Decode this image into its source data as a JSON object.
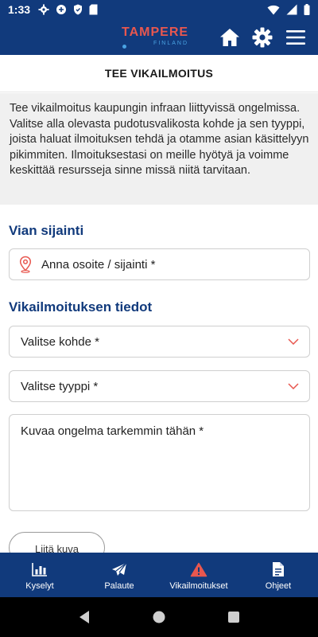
{
  "status": {
    "time": "1:33"
  },
  "header": {
    "logo_text": "TAMPERE",
    "logo_sub": "FINLAND",
    "home_icon": "home-icon",
    "settings_icon": "gear-icon",
    "menu_icon": "hamburger-menu-icon"
  },
  "page": {
    "title": "TEE VIKAILMOITUS",
    "intro": "Tee vikailmoitus kaupungin infraan liittyvissä ongelmissa. Valitse alla olevasta pudotusvalikosta kohde ja sen tyyppi, joista haluat ilmoituksen tehdä ja otamme asian käsittelyyn pikimmiten. Ilmoituksestasi on meille hyötyä ja voimme keskittää resursseja sinne missä niitä tarvitaan."
  },
  "location": {
    "heading": "Vian sijainti",
    "placeholder": "Anna osoite / sijainti *"
  },
  "details": {
    "heading": "Vikailmoituksen tiedot",
    "target_select": "Valitse kohde *",
    "type_select": "Valitse tyyppi *",
    "description_placeholder": "Kuvaa ongelma tarkemmin tähän *",
    "attach_button": "Liitä kuva"
  },
  "tabs": [
    {
      "label": "Kyselyt",
      "icon": "bar-chart-icon"
    },
    {
      "label": "Palaute",
      "icon": "paper-plane-icon"
    },
    {
      "label": "Vikailmoitukset",
      "icon": "warning-icon"
    },
    {
      "label": "Ohjeet",
      "icon": "document-icon"
    }
  ],
  "colors": {
    "brand_blue": "#113a7c",
    "accent_red": "#e8574f",
    "accent_light_blue": "#4aa3e3"
  }
}
